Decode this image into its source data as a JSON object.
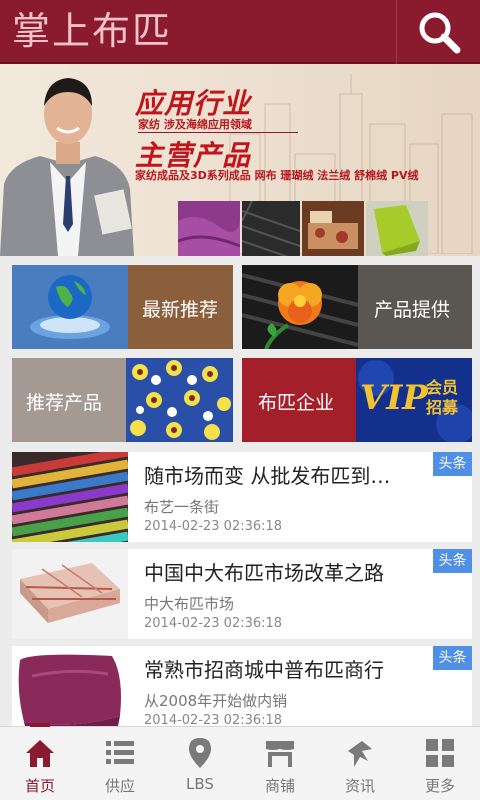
{
  "header": {
    "title": "掌上布匹",
    "search_icon": "search-icon"
  },
  "banner": {
    "heading1": "应用行业",
    "subtitle1": "家纺 涉及海绵应用领域",
    "heading2": "主营产品",
    "subtitle2": "家纺成品及3D系列成品  网布 珊瑚绒 法兰绒 舒棉绒 PV绒",
    "carousel_pages": 3,
    "carousel_active": 1
  },
  "tiles": [
    {
      "label": "最新推荐",
      "icon": "globe-icon",
      "color": "#8b5e3c"
    },
    {
      "label": "产品提供",
      "icon": "flower-fabric-icon",
      "color": "#5a5651"
    },
    {
      "label": "推荐产品",
      "icon": "floral-fabric-icon",
      "color": "#a49993"
    },
    {
      "label": "布匹企业",
      "icon": "vip-icon",
      "color": "#a3202a"
    }
  ],
  "vip_text": "VIP",
  "vip_sub": "会员招募",
  "news": [
    {
      "title": "随市场而变 从批发布匹到…",
      "subtitle": "布艺一条街",
      "date": "2014-02-23 02:36:18",
      "badge": "头条"
    },
    {
      "title": "中国中大布匹市场改革之路",
      "subtitle": "中大布匹市场",
      "date": "2014-02-23 02:36:18",
      "badge": "头条"
    },
    {
      "title": "常熟市招商城中普布匹商行",
      "subtitle": "从2008年开始做内销",
      "date": "2014-02-23 02:36:18",
      "badge": "头条"
    }
  ],
  "nav": [
    {
      "label": "首页",
      "icon": "home-icon",
      "active": true
    },
    {
      "label": "供应",
      "icon": "list-icon",
      "active": false
    },
    {
      "label": "LBS",
      "icon": "location-pin-icon",
      "active": false
    },
    {
      "label": "商铺",
      "icon": "shop-icon",
      "active": false
    },
    {
      "label": "资讯",
      "icon": "news-icon",
      "active": false
    },
    {
      "label": "更多",
      "icon": "grid-icon",
      "active": false
    }
  ],
  "colors": {
    "brand": "#8a1a2e",
    "badge": "#4f8fe6",
    "banner_red": "#c0151b"
  }
}
